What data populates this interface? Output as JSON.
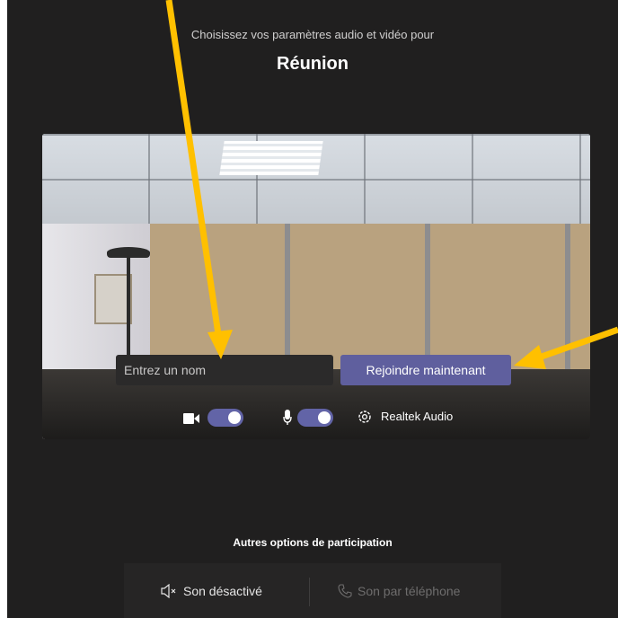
{
  "header": {
    "subtitle": "Choisissez vos paramètres audio et vidéo pour",
    "title": "Réunion"
  },
  "join_form": {
    "name_placeholder": "Entrez un nom",
    "name_value": "",
    "join_label": "Rejoindre maintenant"
  },
  "device_controls": {
    "camera_icon": "video-camera-icon",
    "camera_on": true,
    "mic_icon": "microphone-icon",
    "mic_on": true,
    "settings_icon": "gear-icon",
    "audio_device": "Realtek Audio"
  },
  "other_options": {
    "heading": "Autres options de participation",
    "audio_off_label": "Son désactivé",
    "audio_off_icon": "speaker-muted-icon",
    "phone_label": "Son par téléphone",
    "phone_icon": "phone-icon"
  },
  "colors": {
    "background": "#201f1f",
    "accent": "#6264a7",
    "annotation_arrow": "#ffc000"
  }
}
